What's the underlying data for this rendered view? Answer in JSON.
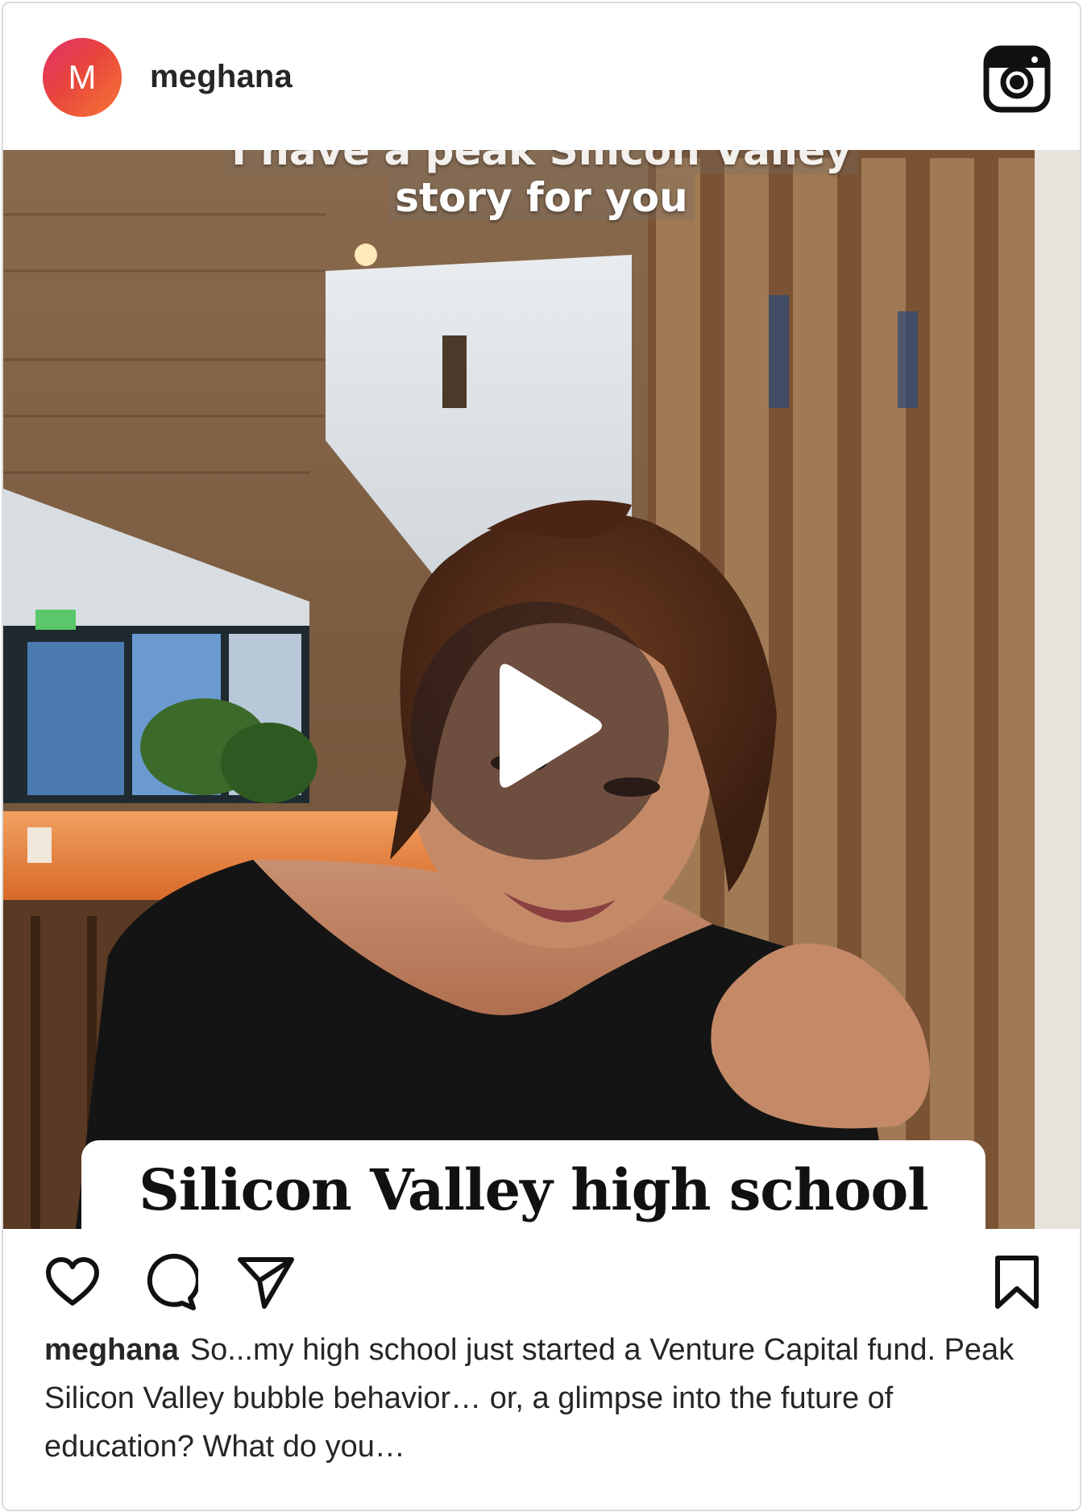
{
  "post": {
    "avatar_initial": "M",
    "username": "meghana",
    "brand_icon": "instagram-icon",
    "media": {
      "type": "video",
      "overlay_top_line1": "I have a peak Silicon Valley",
      "overlay_top_line2": "story for you",
      "overlay_bottom": "Silicon Valley high school",
      "play_icon": "play-icon"
    },
    "actions": {
      "like_icon": "heart-icon",
      "comment_icon": "comment-icon",
      "share_icon": "send-icon",
      "save_icon": "bookmark-icon"
    },
    "caption": {
      "username": "meghana",
      "text": "So...my high school just started a Venture Capital fund. Peak Silicon Valley bubble behavior… or, a glimpse into the future of education? What do you…"
    }
  },
  "colors": {
    "avatar_gradient_start": "#e1306c",
    "avatar_gradient_end": "#f77737",
    "text": "#262626",
    "border": "#dbdbdb"
  }
}
